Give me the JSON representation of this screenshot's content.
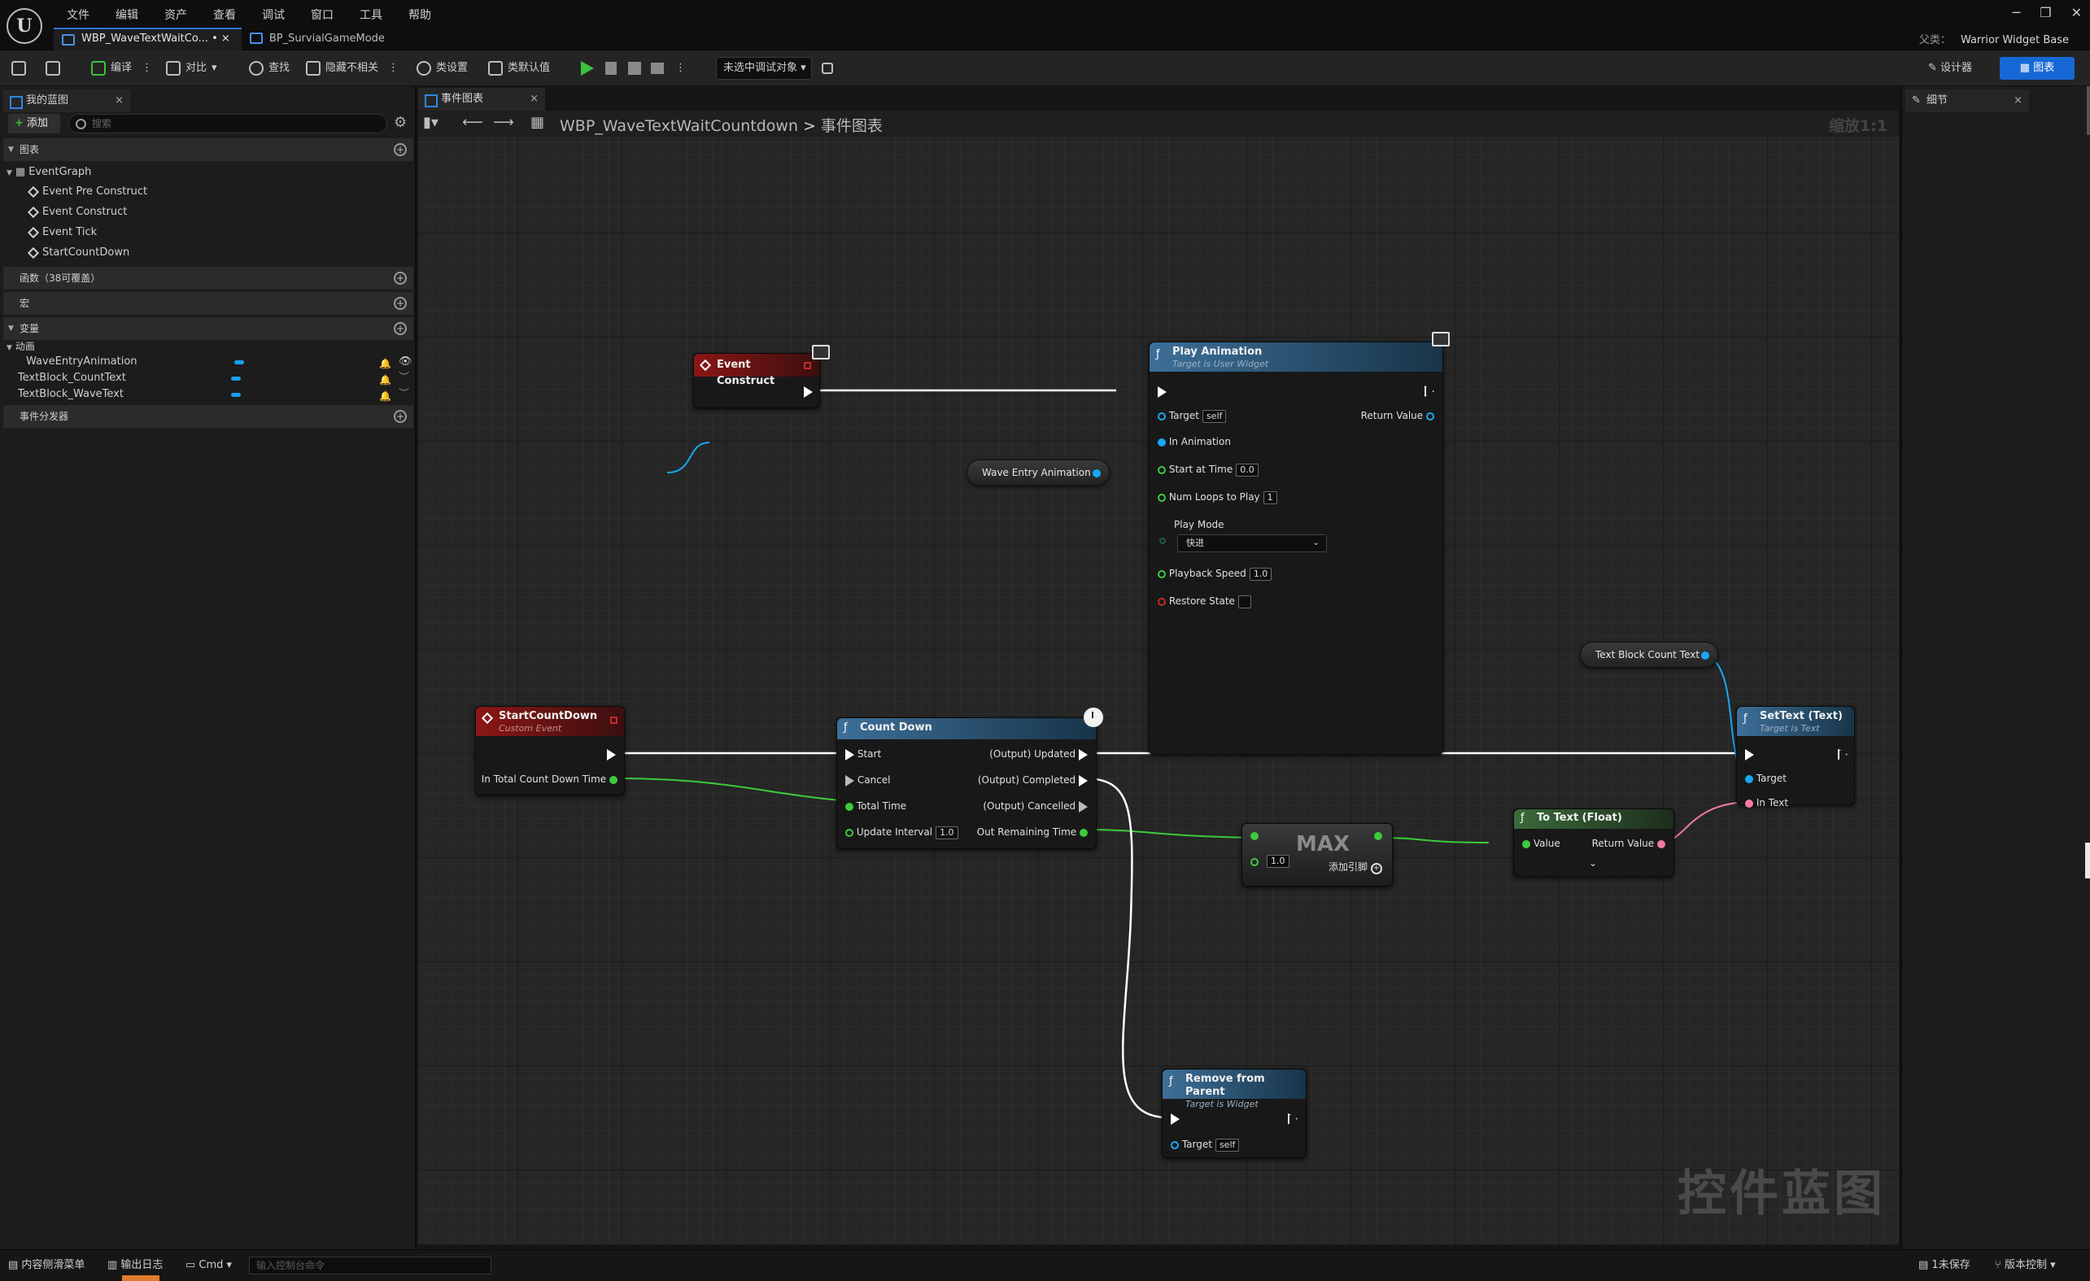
{
  "menu": [
    "文件",
    "编辑",
    "资产",
    "查看",
    "调试",
    "窗口",
    "工具",
    "帮助"
  ],
  "tabs": [
    {
      "label": "WBP_WaveTextWaitCo... • ×",
      "active": true
    },
    {
      "label": "BP_SurvialGameMode",
      "active": false
    }
  ],
  "window_controls": {
    "min": "─",
    "restore": "❐",
    "close": "✕"
  },
  "parent": {
    "label": "父类：",
    "value": "Warrior Widget Base"
  },
  "toolbar": {
    "compile": "编译",
    "diff": "对比",
    "find": "查找",
    "hide_unrelated": "隐藏不相关",
    "class_settings": "类设置",
    "class_defaults": "类默认值",
    "debug_select": "未选中调试对象",
    "designer": "设计器",
    "graph": "图表"
  },
  "left_panel": {
    "tab": "我的蓝图",
    "add": "添加",
    "search_placeholder": "搜索",
    "sections": {
      "graphs": "图表",
      "functions": "函数（38可覆盖）",
      "macros": "宏",
      "variables": "变量",
      "dispatchers": "事件分发器"
    },
    "event_graph": "EventGraph",
    "events": [
      "Event Pre Construct",
      "Event Construct",
      "Event Tick",
      "StartCountDown"
    ],
    "var_category": "动画",
    "variables": [
      "WaveEntryAnimation",
      "TextBlock_CountText",
      "TextBlock_WaveText"
    ]
  },
  "graph": {
    "tab": "事件图表",
    "breadcrumb_bp": "WBP_WaveTextWaitCountdown",
    "breadcrumb_sep": ">",
    "breadcrumb_graph": "事件图表",
    "zoom": "缩放1:1",
    "watermark": "控件蓝图"
  },
  "nodes": {
    "event_construct": {
      "title": "Event Construct"
    },
    "play_animation": {
      "title": "Play Animation",
      "subtitle": "Target is User Widget",
      "target": "Target",
      "target_val": "self",
      "return_value": "Return Value",
      "in_animation": "In Animation",
      "start_at_time": "Start at Time",
      "start_at_time_val": "0.0",
      "num_loops": "Num Loops to Play",
      "num_loops_val": "1",
      "play_mode": "Play Mode",
      "play_mode_val": "快进",
      "playback_speed": "Playback Speed",
      "playback_speed_val": "1.0",
      "restore_state": "Restore State"
    },
    "wave_entry_animation": {
      "label": "Wave Entry Animation"
    },
    "text_block_count_text": {
      "label": "Text Block Count Text"
    },
    "start_count_down": {
      "title": "StartCountDown",
      "subtitle": "Custom Event",
      "in_total": "In Total Count Down Time"
    },
    "count_down": {
      "title": "Count Down",
      "start": "Start",
      "cancel": "Cancel",
      "total_time": "Total Time",
      "update_interval": "Update Interval",
      "update_interval_val": "1.0",
      "updated": "(Output) Updated",
      "completed": "(Output) Completed",
      "cancelled": "(Output) Cancelled",
      "out_remaining": "Out Remaining Time"
    },
    "max": {
      "label": "MAX",
      "input_val": "1.0",
      "add_pin": "添加引脚"
    },
    "to_text": {
      "title": "To Text (Float)",
      "value": "Value",
      "return_value": "Return Value"
    },
    "set_text": {
      "title": "SetText (Text)",
      "subtitle": "Target is Text",
      "target": "Target",
      "in_text": "In Text"
    },
    "remove_from_parent": {
      "title": "Remove from Parent",
      "subtitle": "Target is Widget",
      "target": "Target",
      "target_val": "self"
    }
  },
  "right_panel": {
    "tab": "细节"
  },
  "statusbar": {
    "content_drawer": "内容侧滑菜单",
    "output_log": "输出日志",
    "cmd": "Cmd",
    "cmd_placeholder": "输入控制台命令",
    "unsaved": "1未保存",
    "revision_control": "版本控制"
  },
  "colors": {
    "exec": "#ffffff",
    "object_pin": "#19a7f5",
    "float_pin": "#3ccb3c",
    "text_pin": "#f27aa8",
    "accent": "#1668d6"
  }
}
